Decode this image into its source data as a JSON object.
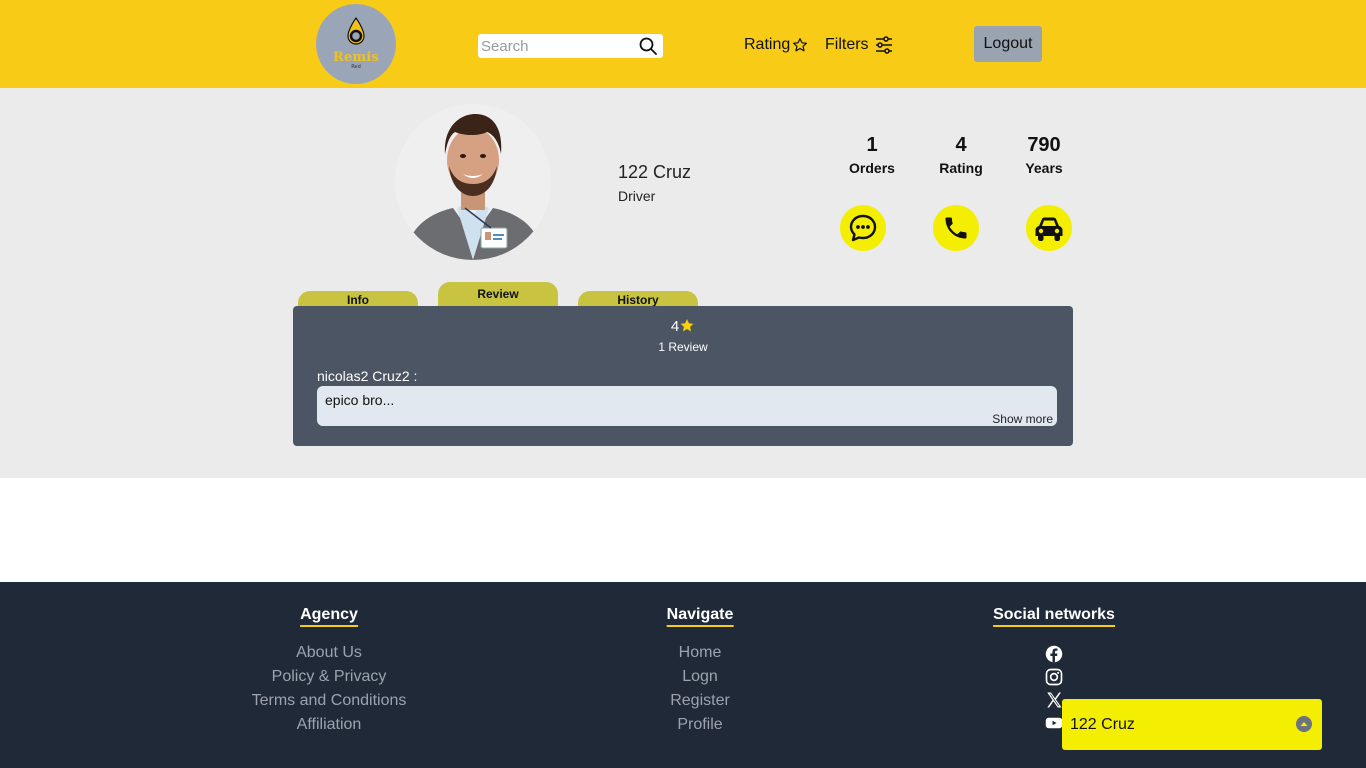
{
  "header": {
    "logo_text": "Remis",
    "logo_sub": "Red",
    "search_placeholder": "Search",
    "rating_label": "Rating",
    "filters_label": "Filters",
    "logout_label": "Logout",
    "brand_color": "#f8cb17"
  },
  "profile": {
    "name": "122 Cruz",
    "role": "Driver",
    "stats": [
      {
        "value": "1",
        "label": "Orders"
      },
      {
        "value": "4",
        "label": "Rating"
      },
      {
        "value": "790",
        "label": "Years"
      }
    ],
    "actions": [
      {
        "icon": "chat-icon"
      },
      {
        "icon": "phone-icon"
      },
      {
        "icon": "car-icon"
      }
    ],
    "action_color": "#f4ee02"
  },
  "tabs": [
    {
      "label": "Info"
    },
    {
      "label": "Review",
      "active": true
    },
    {
      "label": "History"
    }
  ],
  "reviews": {
    "rating": "4",
    "count_label": "1 Review",
    "items": [
      {
        "author": "nicolas2 Cruz2 :",
        "text": "epico bro...",
        "show_more": "Show more"
      }
    ]
  },
  "footer": {
    "agency": {
      "title": "Agency",
      "links": [
        "About Us",
        "Policy & Privacy",
        "Terms and Conditions",
        "Affiliation"
      ]
    },
    "navigate": {
      "title": "Navigate",
      "links": [
        "Home",
        "Logn",
        "Register",
        "Profile"
      ]
    },
    "social": {
      "title": "Social networks",
      "icons": [
        "facebook-icon",
        "instagram-icon",
        "x-icon",
        "youtube-icon"
      ]
    }
  },
  "chat_popup": {
    "name": "122 Cruz"
  }
}
